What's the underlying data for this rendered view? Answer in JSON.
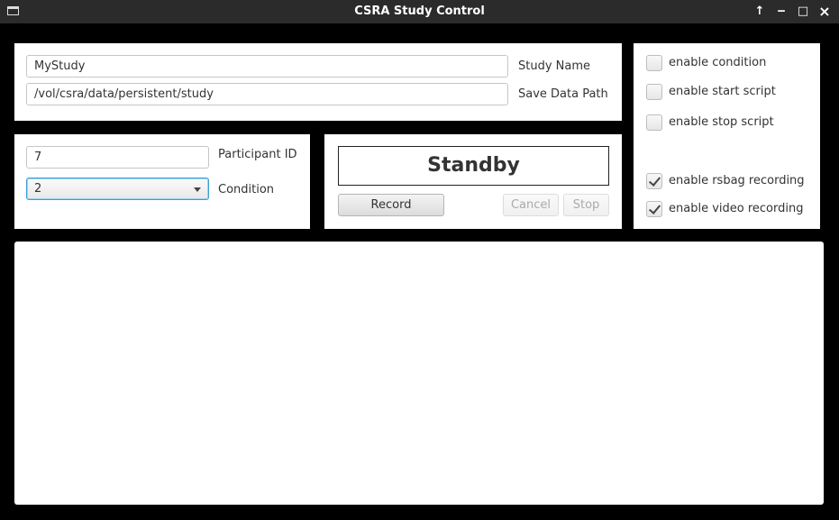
{
  "window": {
    "title": "CSRA Study Control",
    "controls": {
      "maximize_glyph": "↑",
      "minimize_glyph": "‒",
      "restore_glyph": "□",
      "close_glyph": "×"
    }
  },
  "study": {
    "name_value": "MyStudy",
    "name_label": "Study Name",
    "path_value": "/vol/csra/data/persistent/study",
    "path_label": "Save Data Path"
  },
  "participant": {
    "id_value": "7",
    "id_label": "Participant ID",
    "condition_value": "2",
    "condition_label": "Condition"
  },
  "recording": {
    "status": "Standby",
    "record_label": "Record",
    "cancel_label": "Cancel",
    "stop_label": "Stop"
  },
  "options": [
    {
      "label": "enable condition",
      "checked": false
    },
    {
      "label": "enable start script",
      "checked": false
    },
    {
      "label": "enable stop script",
      "checked": false
    },
    {
      "label": "enable rsbag recording",
      "checked": true
    },
    {
      "label": "enable video recording",
      "checked": true
    }
  ],
  "log": {
    "content": ""
  }
}
